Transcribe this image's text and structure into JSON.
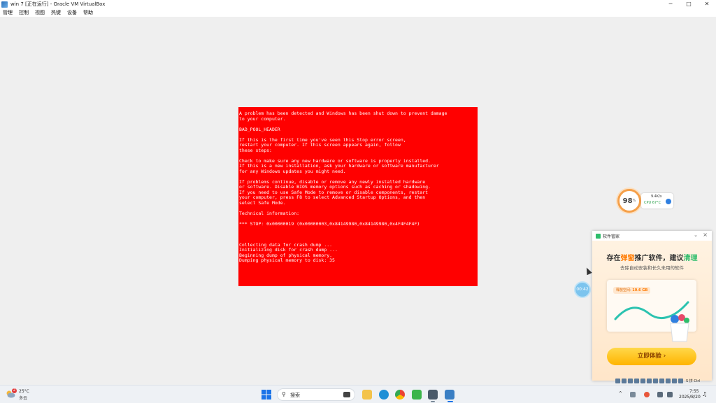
{
  "window": {
    "title": "win 7 [正在运行] - Oracle VM VirtualBox",
    "controls": {
      "minimize": "─",
      "maximize": "□",
      "close": "✕"
    }
  },
  "menu": [
    "管理",
    "控制",
    "视图",
    "热键",
    "设备",
    "帮助"
  ],
  "bsod": {
    "lines": [
      "A problem has been detected and Windows has been shut down to prevent damage",
      "to your computer.",
      "",
      "BAD_POOL_HEADER",
      "",
      "If this is the first time you've seen this Stop error screen,",
      "restart your computer. If this screen appears again, follow",
      "these steps:",
      "",
      "Check to make sure any new hardware or software is properly installed.",
      "If this is a new installation, ask your hardware or software manufacturer",
      "for any Windows updates you might need.",
      "",
      "If problems continue, disable or remove any newly installed hardware",
      "or software. Disable BIOS memory options such as caching or shadowing.",
      "If you need to use Safe Mode to remove or disable components, restart",
      "your computer, press F8 to select Advanced Startup Options, and then",
      "select Safe Mode.",
      "",
      "Technical information:",
      "",
      "*** STOP: 0x00000019 (0x00000003,0x84149980,0x84149980,0x4F4F4F4F)",
      "",
      "",
      "",
      "Collecting data for crash dump ...",
      "Initializing disk for crash dump ...",
      "Beginning dump of physical memory.",
      "Dumping physical memory to disk:  35"
    ],
    "color": "#ff0000"
  },
  "monitor": {
    "percent": "98",
    "unit": "%",
    "net": "9.4K/s",
    "cpu": "CPU 67°C"
  },
  "timer": "00:42",
  "ad": {
    "brand": "软件管家",
    "headline_pre": "存在",
    "headline_hl": "弹窗",
    "headline_mid": "推广软件，建议",
    "headline_hl2": "清理",
    "subtitle": "去除自动安装和长久未用的软件",
    "chip_label": "释放空间:",
    "chip_value": "10.6 GB",
    "cta": "立即体验 ›",
    "accent": "#ff7a00"
  },
  "tray_top_label": "S 拼 Ctrl",
  "taskbar": {
    "weather_badge": "2",
    "temperature": "25°C",
    "condition": "多云",
    "search_placeholder": "搜索",
    "time": "7:55",
    "date": "2025/8/20"
  }
}
